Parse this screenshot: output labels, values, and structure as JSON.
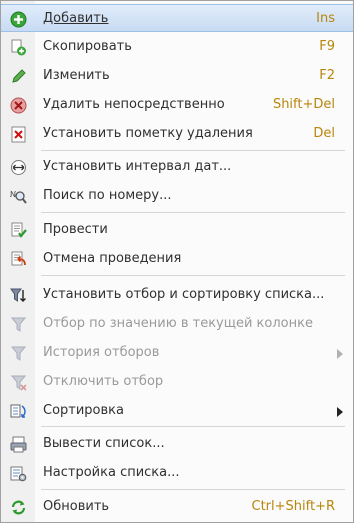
{
  "menu": {
    "items": [
      {
        "label": "Добавить",
        "shortcut": "Ins",
        "icon": "add-icon"
      },
      {
        "label": "Скопировать",
        "shortcut": "F9",
        "icon": "copy-icon"
      },
      {
        "label": "Изменить",
        "shortcut": "F2",
        "icon": "edit-pencil-icon"
      },
      {
        "label": "Удалить непосредственно",
        "shortcut": "Shift+Del",
        "icon": "delete-icon"
      },
      {
        "label": "Установить пометку удаления",
        "shortcut": "Del",
        "icon": "mark-delete-icon"
      },
      {
        "label": "Установить интервал дат...",
        "icon": "date-interval-icon"
      },
      {
        "label": "Поиск по номеру...",
        "icon": "search-number-icon"
      },
      {
        "label": "Провести",
        "icon": "post-document-icon"
      },
      {
        "label": "Отмена проведения",
        "icon": "cancel-posting-icon"
      },
      {
        "label": "Установить отбор и сортировку списка...",
        "icon": "filter-sort-icon"
      },
      {
        "label": "Отбор по значению в текущей колонке",
        "icon": "filter-by-value-icon"
      },
      {
        "label": "История отборов",
        "icon": "filter-history-icon"
      },
      {
        "label": "Отключить отбор",
        "icon": "filter-off-icon"
      },
      {
        "label": "Сортировка",
        "icon": "sort-icon"
      },
      {
        "label": "Вывести список...",
        "icon": "print-list-icon"
      },
      {
        "label": "Настройка списка...",
        "icon": "list-settings-icon"
      },
      {
        "label": "Обновить",
        "shortcut": "Ctrl+Shift+R",
        "icon": "refresh-icon"
      }
    ]
  },
  "colors": {
    "highlight": "#c8dbf3",
    "shortcut": "#b8860b",
    "disabled": "#9a9a9a"
  }
}
